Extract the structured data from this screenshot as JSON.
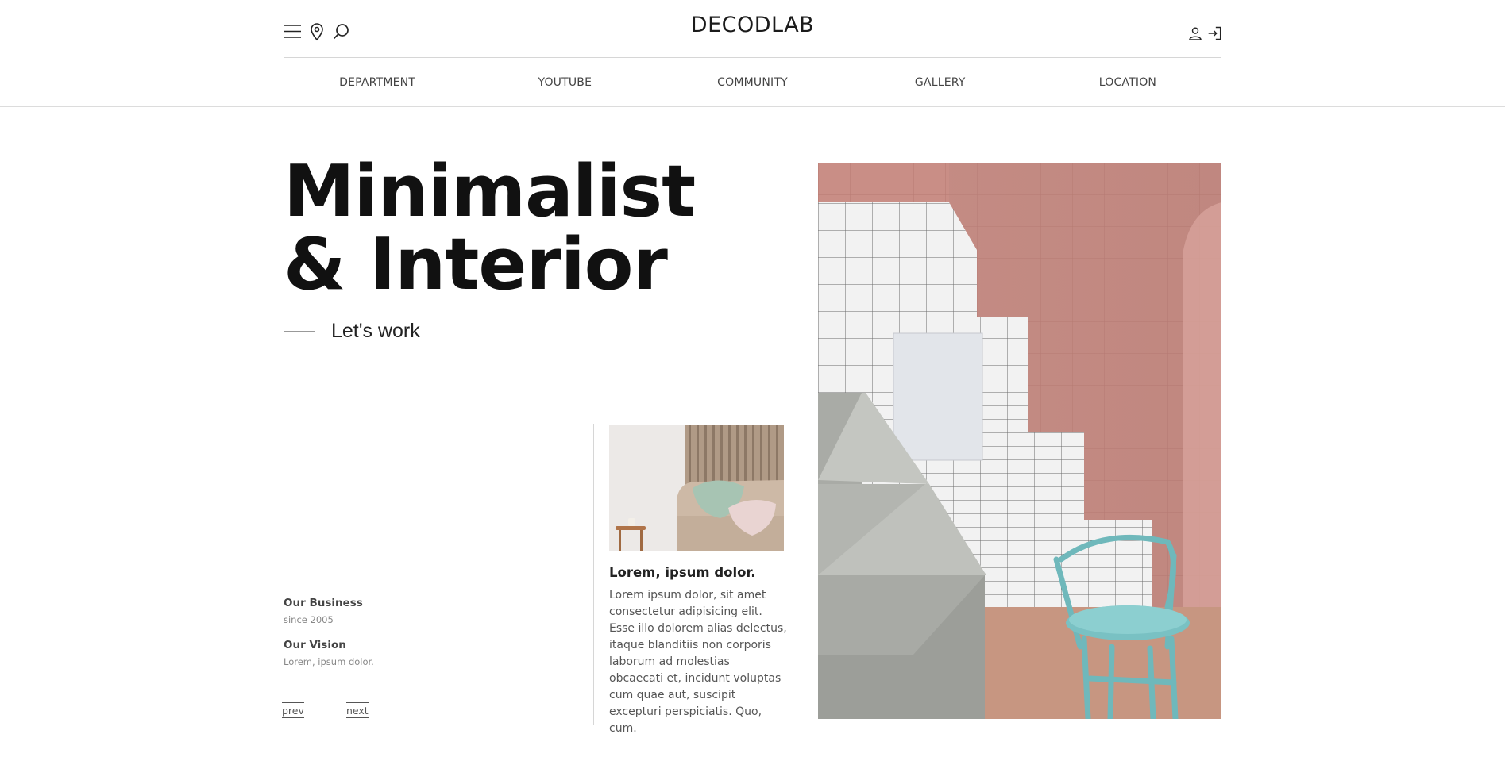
{
  "header": {
    "logo": "DECODLAB",
    "left_icons": [
      "menu-icon",
      "location-pin-icon",
      "search-icon"
    ],
    "right_icons": [
      "user-icon",
      "login-icon"
    ]
  },
  "nav": {
    "items": [
      {
        "label": "DEPARTMENT"
      },
      {
        "label": "YOUTUBE"
      },
      {
        "label": "COMMUNITY"
      },
      {
        "label": "GALLERY"
      },
      {
        "label": "LOCATION"
      }
    ]
  },
  "hero": {
    "title_line1": "Minimalist",
    "title_line2": "& Interior",
    "subtitle": "Let's work"
  },
  "info": {
    "business_title": "Our Business",
    "business_sub": "since 2005",
    "vision_title": "Our Vision",
    "vision_sub": "Lorem, ipsum dolor."
  },
  "pager": {
    "prev": "prev",
    "next": "next"
  },
  "card": {
    "title": "Lorem, ipsum dolor.",
    "body": "Lorem ipsum dolor, sit amet consectetur adipisicing elit. Esse illo dolorem alias delectus, itaque blanditiis non corporis laborum ad molestias obcaecati et, incidunt voluptas cum quae aut, suscipit excepturi perspiciatis. Quo, cum."
  },
  "colors": {
    "text": "#111111",
    "muted": "#888888",
    "border": "#dcdcdc"
  }
}
